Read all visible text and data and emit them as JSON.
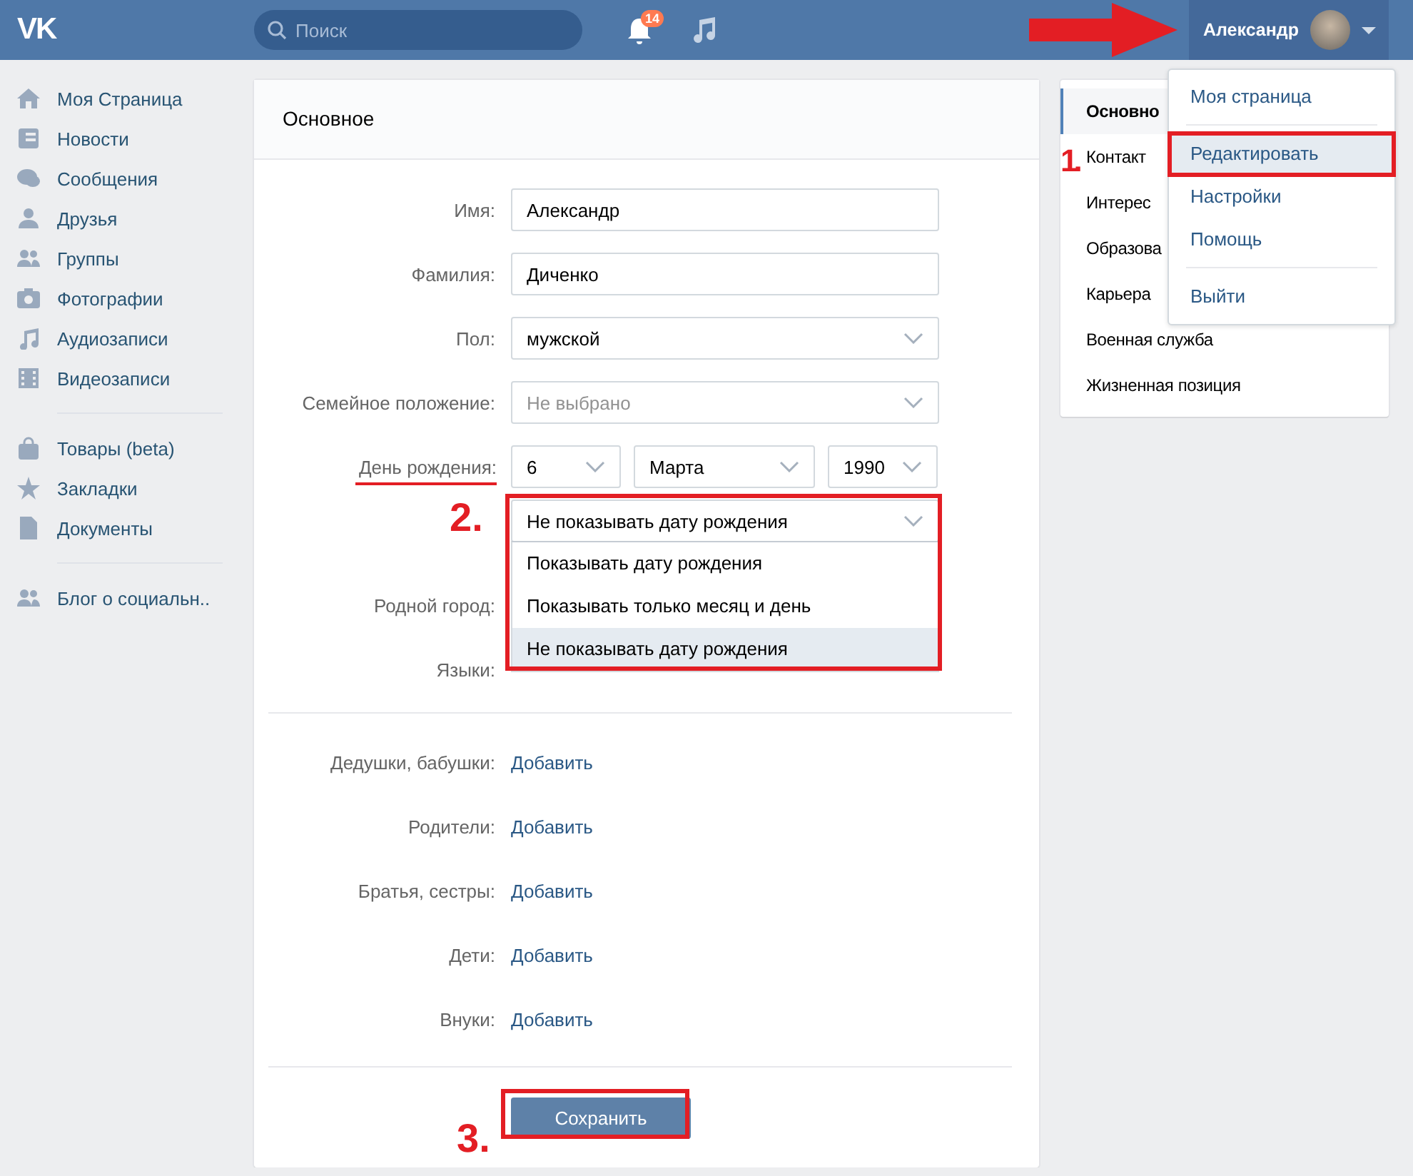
{
  "header": {
    "logo": "VK",
    "search": {
      "placeholder": "Поиск"
    },
    "notifications": {
      "count": "14"
    },
    "user": {
      "name": "Александр"
    }
  },
  "user_menu": {
    "groups": [
      [
        {
          "label": "Моя страница",
          "selected": false,
          "marked": false
        }
      ],
      [
        {
          "label": "Редактировать",
          "selected": true,
          "marked": true
        },
        {
          "label": "Настройки",
          "selected": false,
          "marked": false
        },
        {
          "label": "Помощь",
          "selected": false,
          "marked": false
        }
      ],
      [
        {
          "label": "Выйти",
          "selected": false,
          "marked": false
        }
      ]
    ]
  },
  "sidebar": {
    "groups": [
      [
        "Моя Страница",
        "Новости",
        "Сообщения",
        "Друзья",
        "Группы",
        "Фотографии",
        "Аудиозаписи",
        "Видеозаписи"
      ],
      [
        "Товары (beta)",
        "Закладки",
        "Документы"
      ],
      [
        "Блог о социальн.."
      ]
    ]
  },
  "basic": {
    "title": "Основное",
    "fields": [
      {
        "kind": "text",
        "label": "Имя:",
        "value": "Александр"
      },
      {
        "kind": "text",
        "label": "Фамилия:",
        "value": "Диченко"
      },
      {
        "kind": "select",
        "label": "Пол:",
        "value": "мужской"
      },
      {
        "kind": "placeholder",
        "label": "Семейное положение:",
        "placeholder": "Не выбрано"
      },
      {
        "kind": "date",
        "label": "День рождения:",
        "underlined": true,
        "day": "6",
        "month": "Марта",
        "year": "1990"
      },
      {
        "kind": "visibility",
        "step": "2.",
        "marked": true,
        "value": "Не показывать дату рождения",
        "options": [
          {
            "label": "Показывать дату рождения",
            "selected": false
          },
          {
            "label": "Показывать только месяц и день",
            "selected": false
          },
          {
            "label": "Не показывать дату рождения",
            "selected": true
          }
        ]
      },
      {
        "kind": "covered",
        "label": "Родной город:"
      },
      {
        "kind": "covered",
        "label": "Языки:"
      }
    ],
    "relatives": [
      {
        "label": "Дедушки, бабушки:",
        "link": "Добавить"
      },
      {
        "label": "Родители:",
        "link": "Добавить"
      },
      {
        "label": "Братья, сестры:",
        "link": "Добавить"
      },
      {
        "label": "Дети:",
        "link": "Добавить"
      },
      {
        "label": "Внуки:",
        "link": "Добавить"
      }
    ],
    "save": {
      "label": "Сохранить",
      "step": "3.",
      "marked": true
    }
  },
  "sections": {
    "step": "1.",
    "items": [
      {
        "label": "Основно",
        "selected": true
      },
      {
        "label": "Контакт",
        "selected": false
      },
      {
        "label": "Интерес",
        "selected": false
      },
      {
        "label": "Образова",
        "selected": false
      },
      {
        "label": "Карьера",
        "selected": false
      },
      {
        "label": "Военная служба",
        "selected": false
      },
      {
        "label": "Жизненная позиция",
        "selected": false
      }
    ]
  }
}
